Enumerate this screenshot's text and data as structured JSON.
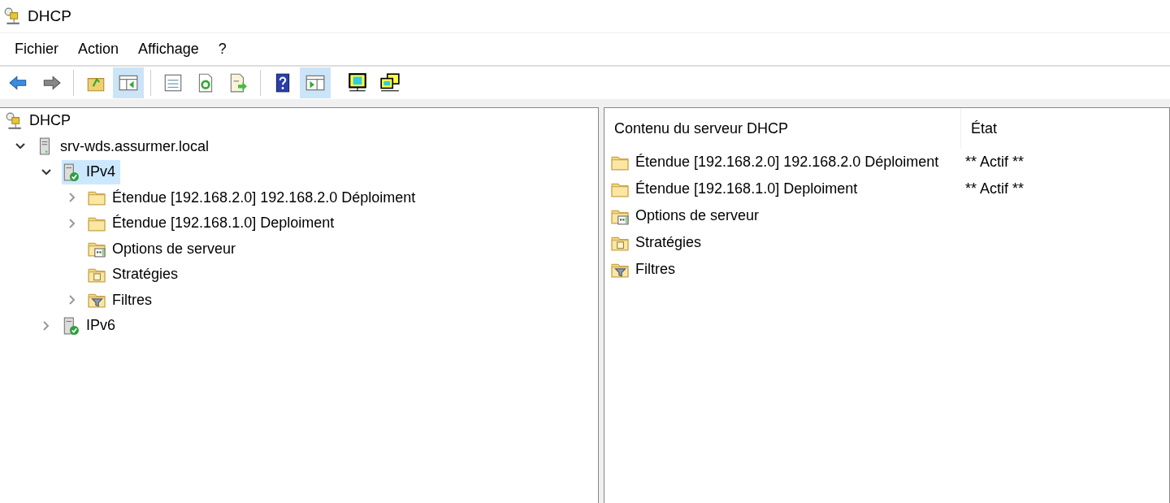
{
  "window": {
    "title": "DHCP"
  },
  "menu": [
    "Fichier",
    "Action",
    "Affichage",
    "?"
  ],
  "toolbar": [
    {
      "kind": "back",
      "pressed": false
    },
    {
      "kind": "forward",
      "pressed": false
    },
    {
      "kind": "sep"
    },
    {
      "kind": "up",
      "pressed": false
    },
    {
      "kind": "tree-pane",
      "pressed": true
    },
    {
      "kind": "sep"
    },
    {
      "kind": "properties",
      "pressed": false
    },
    {
      "kind": "refresh",
      "pressed": false
    },
    {
      "kind": "export",
      "pressed": false
    },
    {
      "kind": "sep"
    },
    {
      "kind": "help",
      "pressed": false
    },
    {
      "kind": "action-pane",
      "pressed": true
    },
    {
      "kind": "sep-none"
    },
    {
      "kind": "monitor",
      "pressed": false
    },
    {
      "kind": "monitors",
      "pressed": false
    }
  ],
  "tree": [
    {
      "label": "DHCP",
      "kind": "dhcp",
      "selected": false,
      "children": [
        {
          "label": "srv-wds.assurmer.local",
          "kind": "server",
          "selected": false,
          "expanded": true,
          "children": [
            {
              "label": "IPv4",
              "kind": "server-ok",
              "selected": true,
              "expanded": true,
              "children": [
                {
                  "label": "Étendue [192.168.2.0] 192.168.2.0 Déploiment",
                  "kind": "folder",
                  "selected": false,
                  "expanded": false
                },
                {
                  "label": "Étendue [192.168.1.0] Deploiment",
                  "kind": "folder",
                  "selected": false,
                  "expanded": false
                },
                {
                  "label": "Options de serveur",
                  "kind": "options",
                  "selected": false
                },
                {
                  "label": "Stratégies",
                  "kind": "policy",
                  "selected": false
                },
                {
                  "label": "Filtres",
                  "kind": "filter",
                  "selected": false,
                  "expanded": false
                }
              ]
            },
            {
              "label": "IPv6",
              "kind": "server-ok",
              "selected": false,
              "expanded": false
            }
          ]
        }
      ]
    }
  ],
  "list": {
    "columns": [
      "Contenu du serveur DHCP",
      "État"
    ],
    "rows": [
      {
        "kind": "folder",
        "name": "Étendue [192.168.2.0] 192.168.2.0 Déploiment",
        "state": "** Actif **"
      },
      {
        "kind": "folder",
        "name": "Étendue [192.168.1.0] Deploiment",
        "state": "** Actif **"
      },
      {
        "kind": "options",
        "name": "Options de serveur"
      },
      {
        "kind": "policy",
        "name": "Stratégies"
      },
      {
        "kind": "filter",
        "name": "Filtres"
      }
    ]
  }
}
